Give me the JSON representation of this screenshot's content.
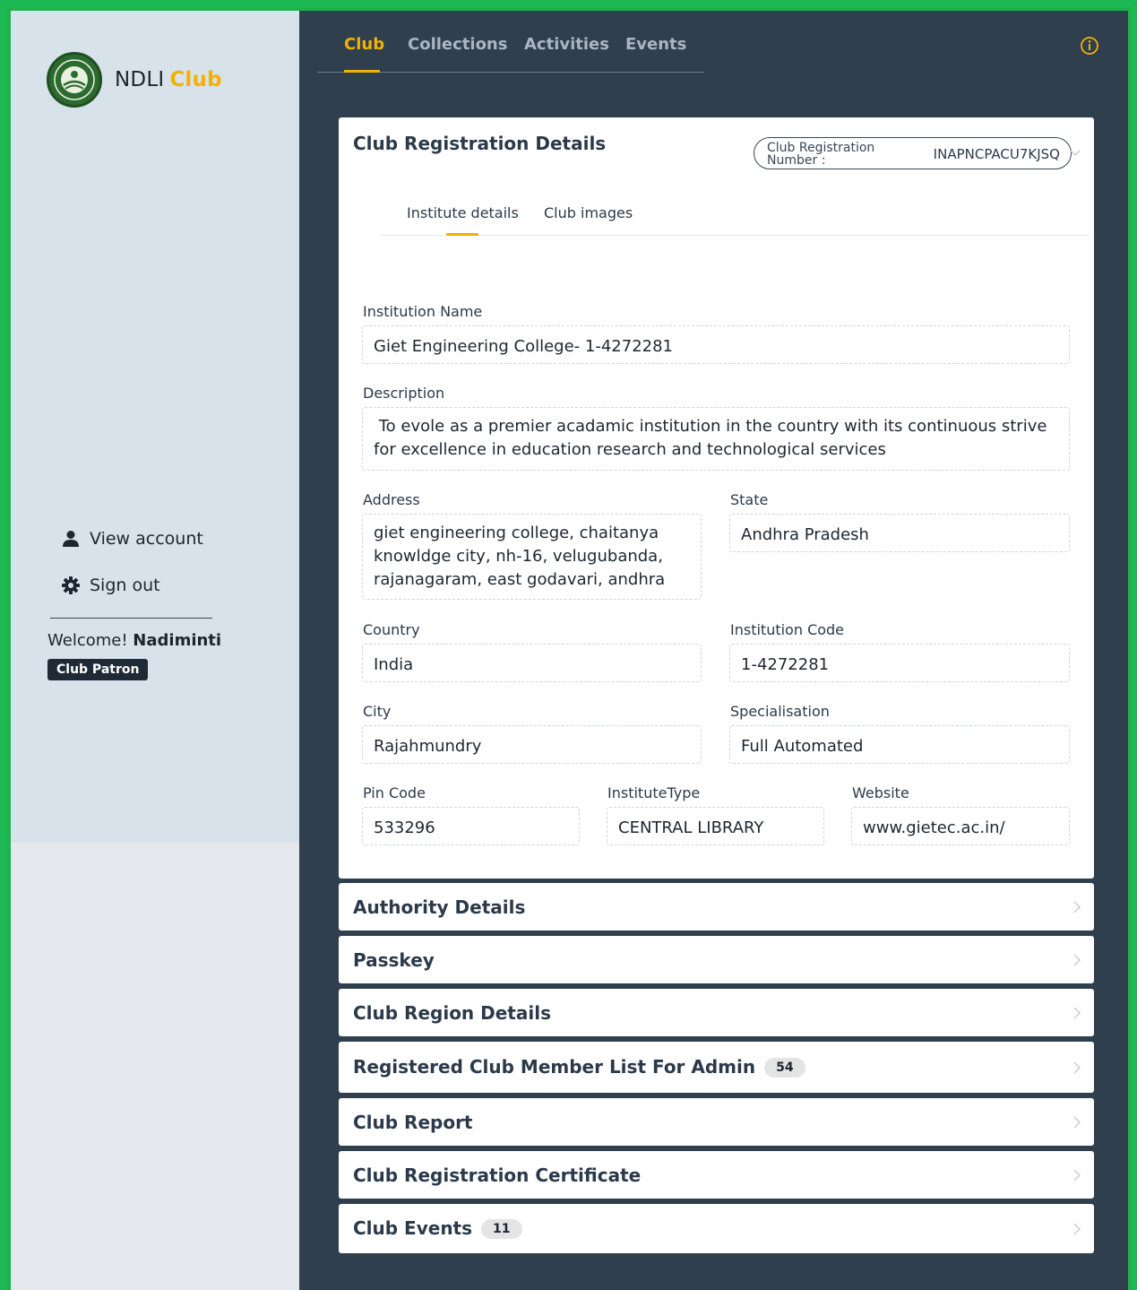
{
  "brand": {
    "name": "NDLI",
    "highlight": "Club"
  },
  "sidebar": {
    "view_account": "View account",
    "sign_out": "Sign out",
    "welcome_prefix": "Welcome!",
    "user_name": "Nadiminti",
    "role": "Club Patron"
  },
  "nav": {
    "tabs": [
      {
        "label": "Club",
        "active": true
      },
      {
        "label": "Collections",
        "active": false
      },
      {
        "label": "Activities",
        "active": false
      },
      {
        "label": "Events",
        "active": false
      }
    ]
  },
  "registration": {
    "title": "Club Registration Details",
    "number_label": "Club Registration Number :",
    "number_value": "INAPNCPACU7KJSQ",
    "subtabs": [
      "Institute details",
      "Club images"
    ],
    "fields": {
      "institution_name": {
        "label": "Institution Name",
        "value": "Giet Engineering College- 1-4272281"
      },
      "description": {
        "label": "Description",
        "value": " To evole as a premier acadamic institution in the country with its continuous strive for excellence in education research and technological services"
      },
      "address": {
        "label": "Address",
        "value": "giet engineering college, chaitanya knowldge city, nh-16, velugubanda, rajanagaram, east godavari, andhra"
      },
      "state": {
        "label": "State",
        "value": "Andhra Pradesh"
      },
      "country": {
        "label": "Country",
        "value": "India"
      },
      "institution_code": {
        "label": "Institution Code",
        "value": "1-4272281"
      },
      "city": {
        "label": "City",
        "value": "Rajahmundry"
      },
      "specialisation": {
        "label": "Specialisation",
        "value": "Full Automated"
      },
      "pin_code": {
        "label": "Pin Code",
        "value": "533296"
      },
      "institute_type": {
        "label": "InstituteType",
        "value": "CENTRAL LIBRARY"
      },
      "website": {
        "label": "Website",
        "value": "www.gietec.ac.in/"
      }
    }
  },
  "sections": [
    {
      "title": "Authority Details",
      "count": null
    },
    {
      "title": "Passkey",
      "count": null
    },
    {
      "title": "Club Region Details",
      "count": null
    },
    {
      "title": "Registered Club Member List For Admin",
      "count": "54"
    },
    {
      "title": "Club Report",
      "count": null
    },
    {
      "title": "Club Registration Certificate",
      "count": null
    },
    {
      "title": "Club Events",
      "count": "11"
    }
  ],
  "colors": {
    "accent": "#f0b400",
    "main_bg": "#2f3f4e",
    "sidebar_bg": "#d7e2ea",
    "frame_border": "#1fb14a"
  },
  "icons": [
    "ndli-emblem-icon",
    "user-icon",
    "gear-icon",
    "info-icon",
    "chevron-right-icon",
    "chevron-down-icon"
  ]
}
